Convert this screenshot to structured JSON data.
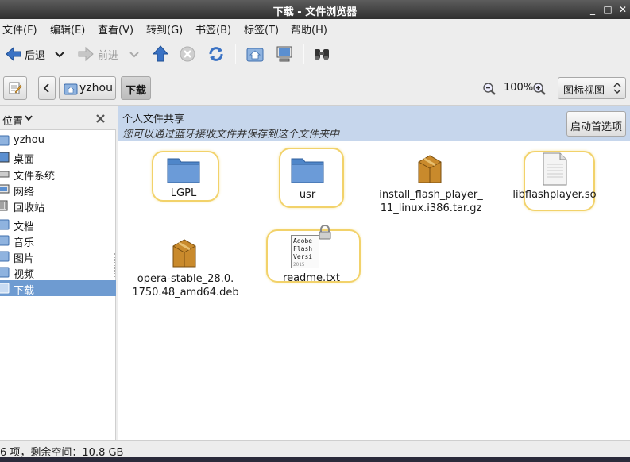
{
  "window": {
    "title": "下载 - 文件浏览器",
    "min_glyph": "_",
    "max_glyph": "□",
    "close_glyph": "✕"
  },
  "menubar": {
    "items": [
      "文件(F)",
      "编辑(E)",
      "查看(V)",
      "转到(G)",
      "书签(B)",
      "标签(T)",
      "帮助(H)"
    ]
  },
  "toolbar": {
    "back_label": "后退",
    "forward_label": "前进"
  },
  "location": {
    "crumbs": [
      "yzhou",
      "下载"
    ],
    "zoom": "100%",
    "view_mode": "图标视图"
  },
  "sidebar": {
    "header": "位置",
    "items": [
      {
        "label": "yzhou",
        "icon": "home-folder-icon"
      },
      {
        "label": "桌面",
        "icon": "desktop-icon"
      },
      {
        "label": "文件系统",
        "icon": "drive-icon"
      },
      {
        "label": "网络",
        "icon": "network-icon"
      },
      {
        "label": "回收站",
        "icon": "trash-icon"
      },
      {
        "label": "文档",
        "icon": "folder-icon"
      },
      {
        "label": "音乐",
        "icon": "folder-icon"
      },
      {
        "label": "图片",
        "icon": "folder-icon"
      },
      {
        "label": "视频",
        "icon": "folder-icon"
      },
      {
        "label": "下载",
        "icon": "folder-icon"
      }
    ],
    "selected": "下载"
  },
  "banner": {
    "title": "个人文件共享",
    "subtitle": "您可以通过蓝牙接收文件并保存到这个文件夹中",
    "button": "启动首选项"
  },
  "files": [
    {
      "name": "LGPL",
      "type": "folder"
    },
    {
      "name": "usr",
      "type": "folder"
    },
    {
      "name_line1": "install_flash_player_",
      "name_line2": "11_linux.i386.tar.gz",
      "type": "archive"
    },
    {
      "name": "libflashplayer.so",
      "type": "library"
    },
    {
      "name_line1": "opera-stable_28.0.",
      "name_line2": "1750.48_amd64.deb",
      "type": "archive"
    },
    {
      "name": "readme.txt",
      "type": "text",
      "preview": [
        "Adobe",
        "Flash",
        "Versi",
        "2015"
      ]
    }
  ],
  "status": {
    "text": "6 项，剩余空间：10.8 GB"
  },
  "colors": {
    "selection": "#6e9bd1",
    "banner": "#c6d6ec",
    "highlight": "#f2d26a",
    "folder": "#5b8fd0"
  }
}
